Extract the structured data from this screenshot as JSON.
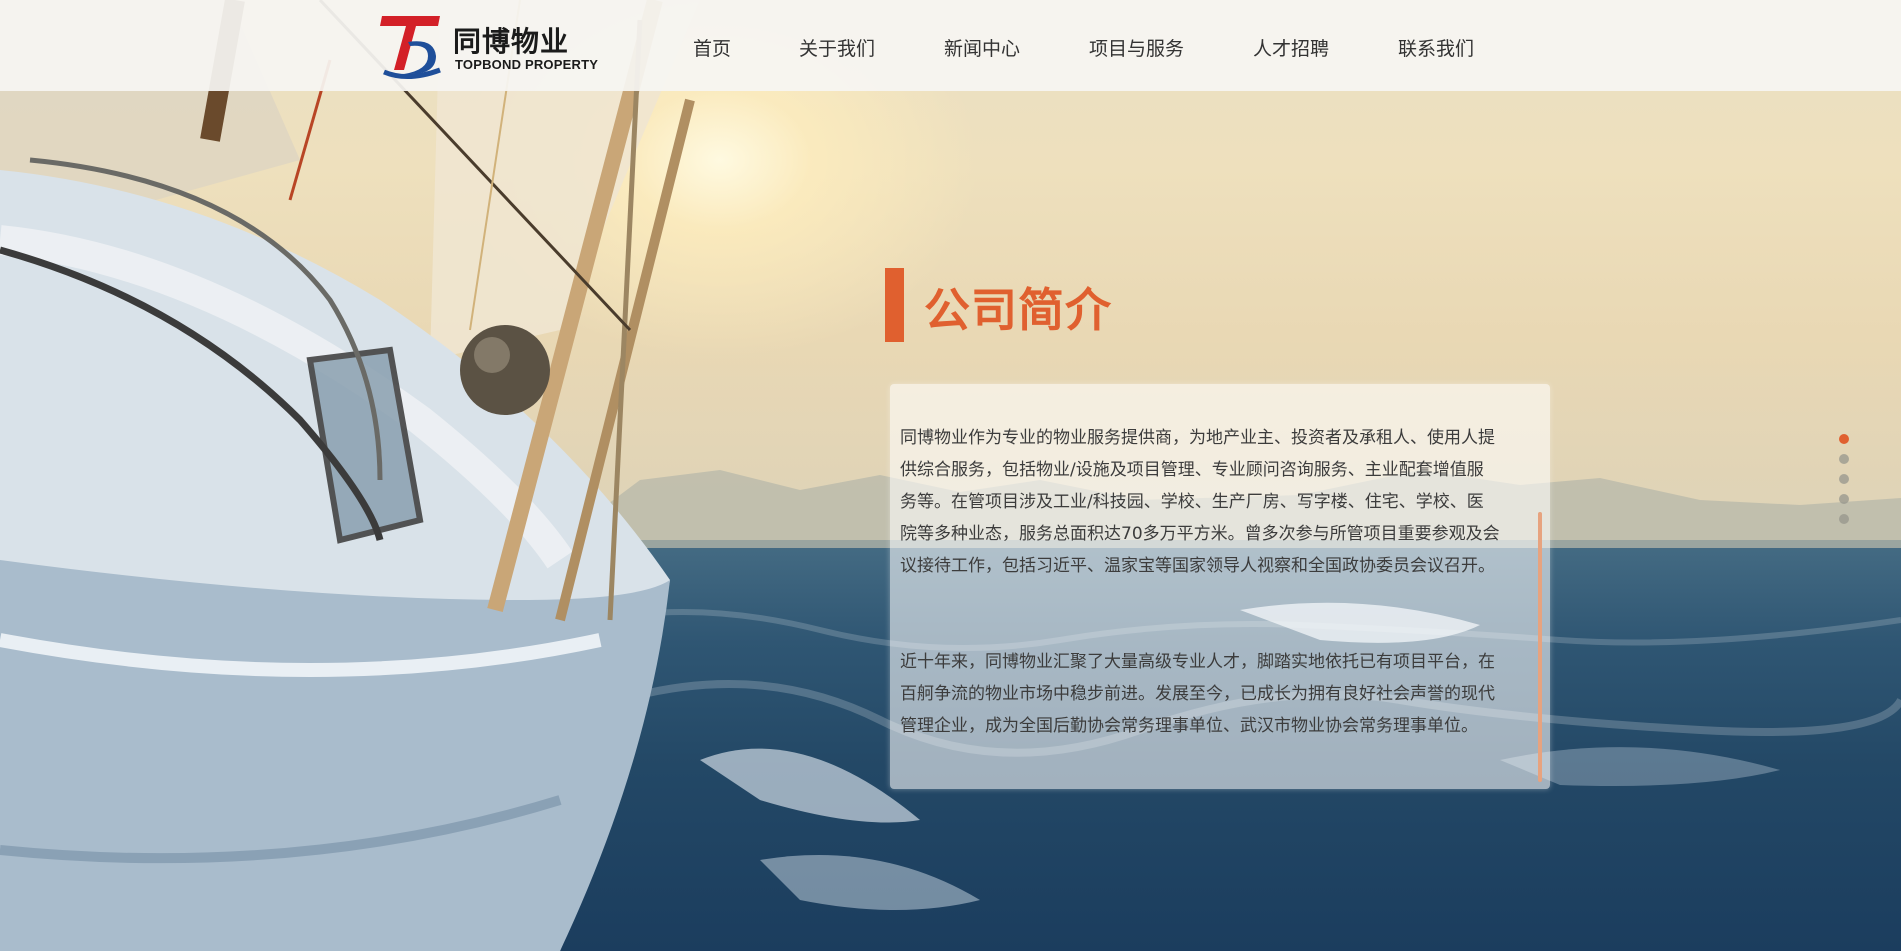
{
  "brand": {
    "name_cn": "同博物业",
    "name_en": "TOPBOND PROPERTY",
    "logo_mark": "T",
    "colors": {
      "accent": "#e0602f",
      "logo_red": "#d32027",
      "logo_blue": "#1f4f9a"
    }
  },
  "nav": {
    "items": [
      {
        "label": "首页"
      },
      {
        "label": "关于我们"
      },
      {
        "label": "新闻中心"
      },
      {
        "label": "项目与服务"
      },
      {
        "label": "人才招聘"
      },
      {
        "label": "联系我们"
      }
    ]
  },
  "section": {
    "title": "公司简介",
    "paragraphs": [
      "同博物业作为专业的物业服务提供商，为地产业主、投资者及承租人、使用人提供综合服务，包括物业/设施及项目管理、专业顾问咨询服务、主业配套增值服务等。在管项目涉及工业/科技园、学校、生产厂房、写字楼、住宅、学校、医院等多种业态，服务总面积达70多万平方米。曾多次参与所管项目重要参观及会议接待工作，包括习近平、温家宝等国家领导人视察和全国政协委员会议召开。",
      "近十年来，同博物业汇聚了大量高级专业人才，脚踏实地依托已有项目平台，在百舸争流的物业市场中稳步前进。发展至今，已成长为拥有良好社会声誉的现代管理企业，成为全国后勤协会常务理事单位、武汉市物业协会常务理事单位。"
    ]
  },
  "pager": {
    "count": 5,
    "active_index": 0
  }
}
